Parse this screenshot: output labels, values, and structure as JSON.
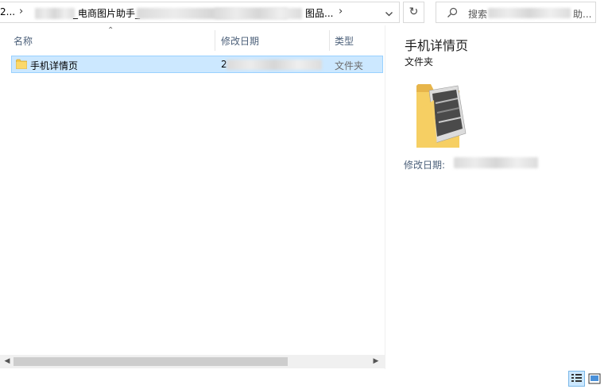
{
  "address_bar": {
    "crumbs": [
      "2...",
      "_电商图片助手_",
      "图品..."
    ],
    "separator": "›"
  },
  "search": {
    "prefix": "搜索",
    "suffix": "助..."
  },
  "columns": {
    "name": "名称",
    "date": "修改日期",
    "type": "类型"
  },
  "files": [
    {
      "name": "手机详情页",
      "date_prefix": "2",
      "type": "文件夹"
    }
  ],
  "details": {
    "name": "手机详情页",
    "type": "文件夹",
    "modified_label": "修改日期:"
  },
  "icons": {
    "folder": "folder-icon",
    "search": "search-icon",
    "refresh": "refresh-icon",
    "dropdown": "chevron-down-icon"
  },
  "colors": {
    "selection_bg": "#cce8ff",
    "selection_border": "#99d1ff",
    "header_text": "#4c607a",
    "folder_yellow": "#f3c94b"
  }
}
